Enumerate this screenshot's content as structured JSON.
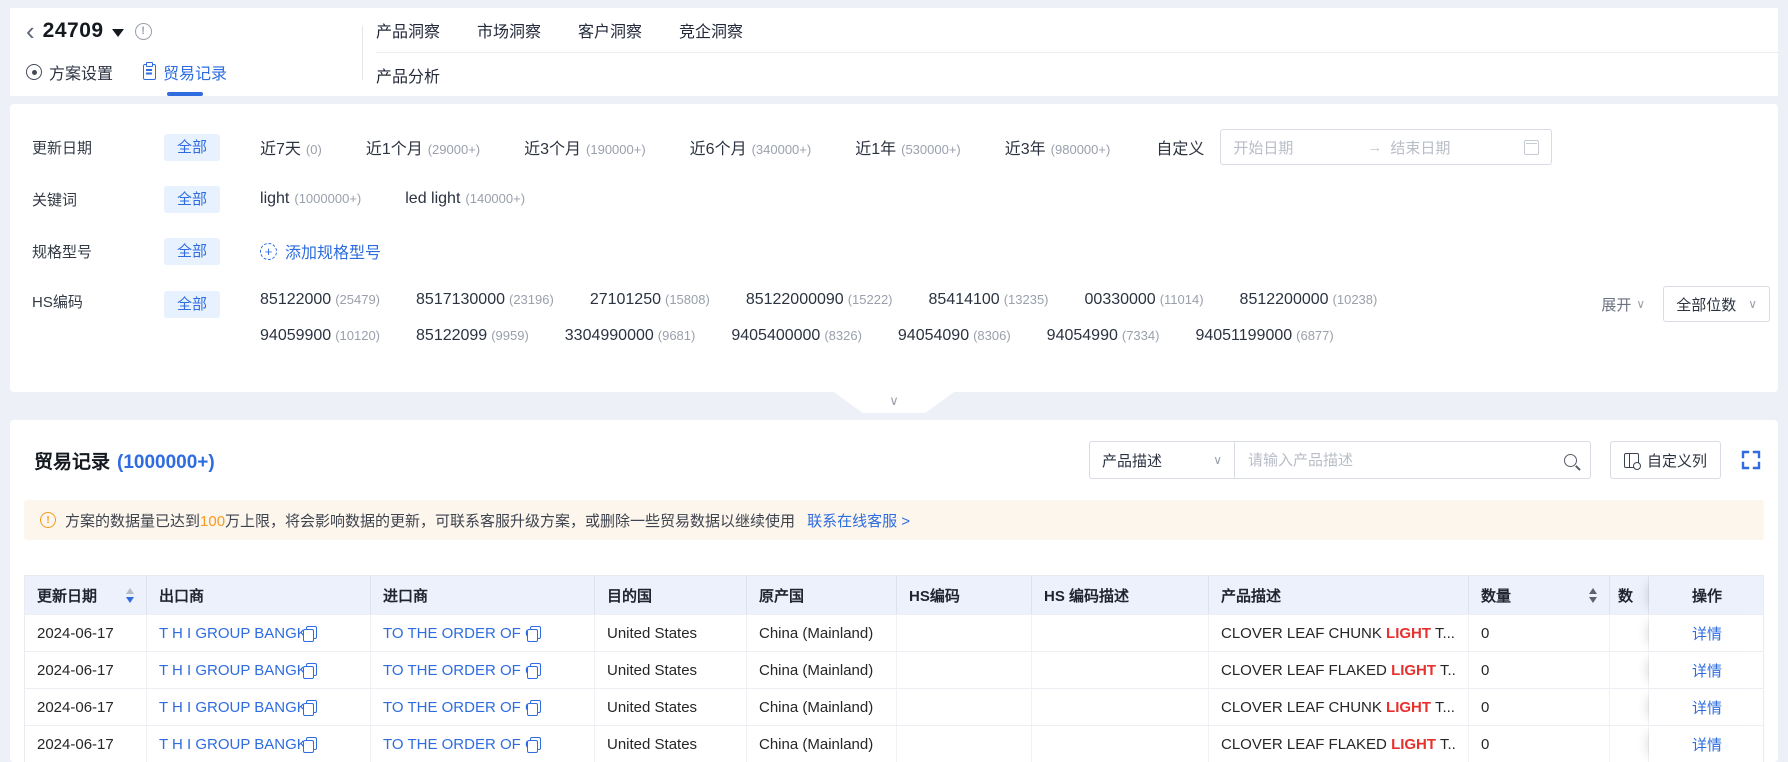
{
  "colors": {
    "accent": "#2e6ce0",
    "highlight_red": "#e8312f",
    "warn_orange": "#f59a23",
    "chip_bg": "#e8f2ff",
    "table_header_bg": "#edf1fb",
    "banner_bg": "#fdf6ec"
  },
  "icons": {
    "back": "‹",
    "info": "!",
    "warning": "!",
    "chevron_down": "∨",
    "arrow_right": "→",
    "plus": "+"
  },
  "header": {
    "plan_id": "24709",
    "nav": [
      "产品洞察",
      "市场洞察",
      "客户洞察",
      "竞企洞察"
    ],
    "subnav": "产品分析",
    "tabs": [
      "方案设置",
      "贸易记录"
    ]
  },
  "filters": {
    "update_date": {
      "label": "更新日期",
      "all": "全部",
      "options": [
        {
          "label": "近7天",
          "count": "(0)"
        },
        {
          "label": "近1个月",
          "count": "(29000+)"
        },
        {
          "label": "近3个月",
          "count": "(190000+)"
        },
        {
          "label": "近6个月",
          "count": "(340000+)"
        },
        {
          "label": "近1年",
          "count": "(530000+)"
        },
        {
          "label": "近3年",
          "count": "(980000+)"
        }
      ],
      "custom": "自定义",
      "start_placeholder": "开始日期",
      "end_placeholder": "结束日期"
    },
    "keyword": {
      "label": "关键词",
      "all": "全部",
      "options": [
        {
          "label": "light",
          "count": "(1000000+)"
        },
        {
          "label": "led light",
          "count": "(140000+)"
        }
      ]
    },
    "spec": {
      "label": "规格型号",
      "all": "全部",
      "add_label": "添加规格型号"
    },
    "hs_code": {
      "label": "HS编码",
      "all": "全部",
      "codes": [
        {
          "code": "85122000",
          "count": "(25479)"
        },
        {
          "code": "8517130000",
          "count": "(23196)"
        },
        {
          "code": "27101250",
          "count": "(15808)"
        },
        {
          "code": "85122000090",
          "count": "(15222)"
        },
        {
          "code": "85414100",
          "count": "(13235)"
        },
        {
          "code": "00330000",
          "count": "(11014)"
        },
        {
          "code": "8512200000",
          "count": "(10238)"
        },
        {
          "code": "94059900",
          "count": "(10120)"
        },
        {
          "code": "85122099",
          "count": "(9959)"
        },
        {
          "code": "3304990000",
          "count": "(9681)"
        },
        {
          "code": "9405400000",
          "count": "(8326)"
        },
        {
          "code": "94054090",
          "count": "(8306)"
        },
        {
          "code": "94054990",
          "count": "(7334)"
        },
        {
          "code": "94051199000",
          "count": "(6877)"
        }
      ],
      "expand": "展开",
      "digits": "全部位数"
    }
  },
  "records": {
    "title": "贸易记录",
    "count": "(1000000+)",
    "search_field": "产品描述",
    "search_placeholder": "请输入产品描述",
    "custom_columns": "自定义列",
    "banner": {
      "pre": "方案的数据量已达到",
      "highlight": "100",
      "post": "万上限，将会影响数据的更新，可联系客服升级方案，或删除一些贸易数据以继续使用",
      "link": "联系在线客服 >"
    },
    "table": {
      "columns": [
        "更新日期",
        "出口商",
        "进口商",
        "目的国",
        "原产国",
        "HS编码",
        "HS 编码描述",
        "产品描述",
        "数量",
        "数",
        "操作"
      ],
      "rows": [
        {
          "date": "2024-06-17",
          "exporter": "T H I GROUP BANGK",
          "importer": "TO THE ORDER OF CL",
          "destination": "United States",
          "origin": "China (Mainland)",
          "hs_code": "",
          "hs_desc": "",
          "desc_pre": "CLOVER LEAF CHUNK ",
          "desc_hl": "LIGHT",
          "desc_post": " T...",
          "qty": "0",
          "qty_unit": "",
          "action": "详情"
        },
        {
          "date": "2024-06-17",
          "exporter": "T H I GROUP BANGK",
          "importer": "TO THE ORDER OF CL",
          "destination": "United States",
          "origin": "China (Mainland)",
          "hs_code": "",
          "hs_desc": "",
          "desc_pre": "CLOVER LEAF FLAKED ",
          "desc_hl": "LIGHT",
          "desc_post": " T...",
          "qty": "0",
          "qty_unit": "",
          "action": "详情"
        },
        {
          "date": "2024-06-17",
          "exporter": "T H I GROUP BANGK",
          "importer": "TO THE ORDER OF CL",
          "destination": "United States",
          "origin": "China (Mainland)",
          "hs_code": "",
          "hs_desc": "",
          "desc_pre": "CLOVER LEAF CHUNK ",
          "desc_hl": "LIGHT",
          "desc_post": " T...",
          "qty": "0",
          "qty_unit": "",
          "action": "详情"
        },
        {
          "date": "2024-06-17",
          "exporter": "T H I GROUP BANGK",
          "importer": "TO THE ORDER OF CL",
          "destination": "United States",
          "origin": "China (Mainland)",
          "hs_code": "",
          "hs_desc": "",
          "desc_pre": "CLOVER LEAF FLAKED ",
          "desc_hl": "LIGHT",
          "desc_post": " T...",
          "qty": "0",
          "qty_unit": "",
          "action": "详情"
        }
      ]
    }
  }
}
